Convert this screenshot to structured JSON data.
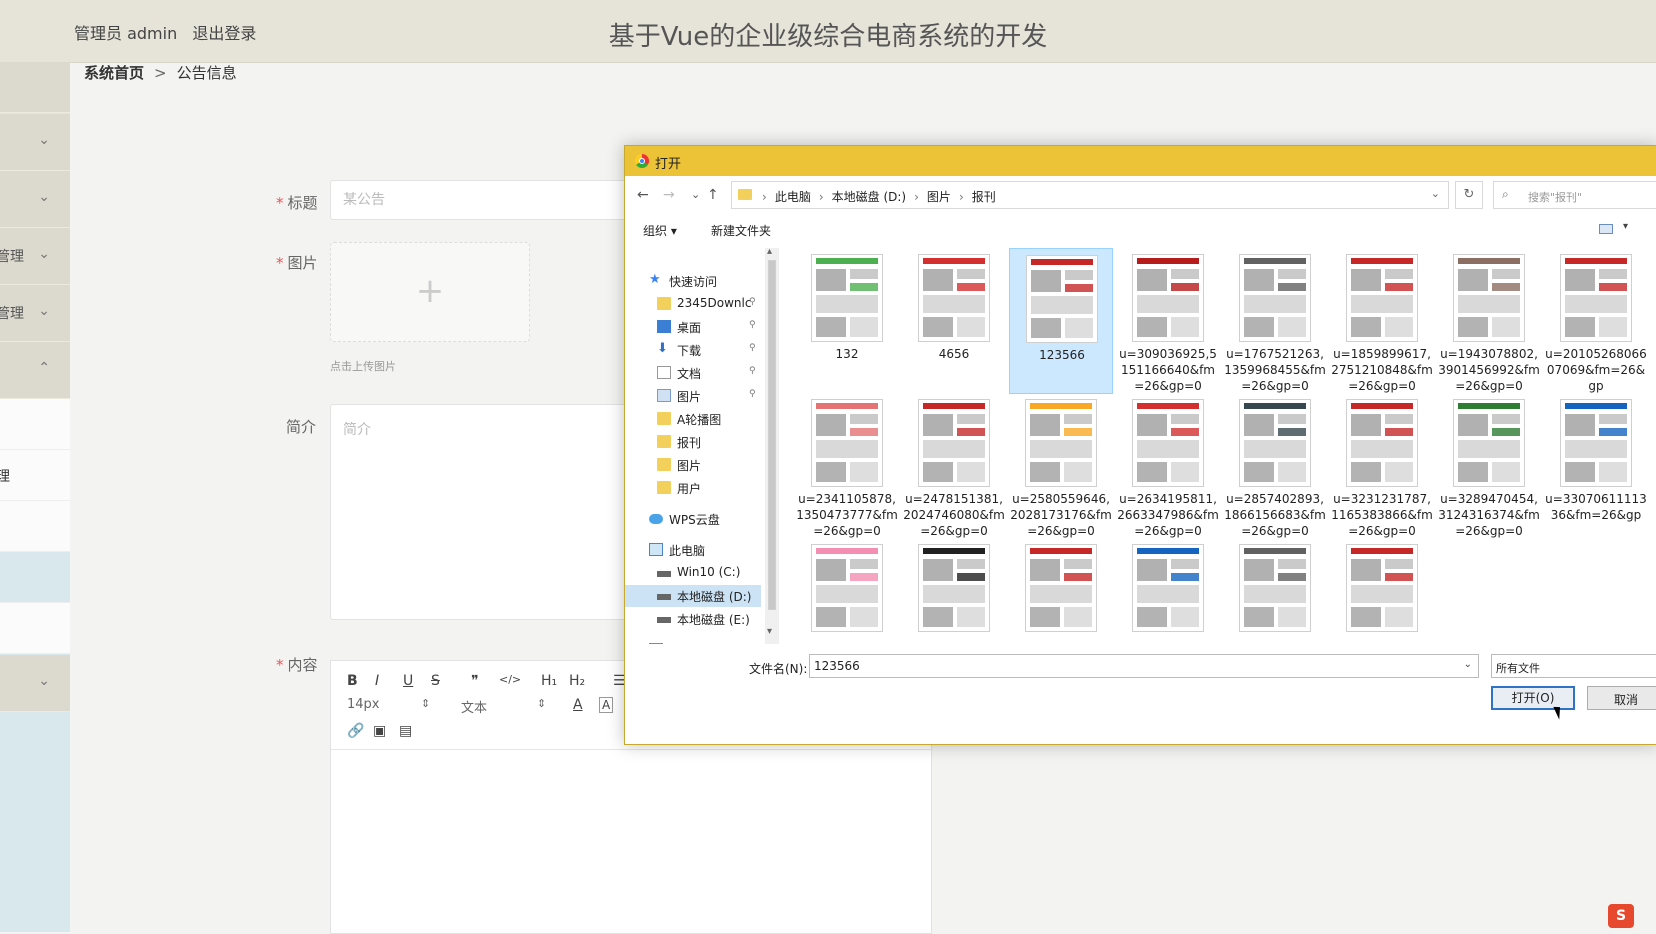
{
  "header": {
    "user_label": "管理员 admin",
    "logout": "退出登录",
    "title": "基于Vue的企业级综合电商系统的开发"
  },
  "sidebar": {
    "items": [
      {
        "label": "",
        "chevron": ""
      },
      {
        "label": "",
        "chevron": "⌄"
      },
      {
        "label": "",
        "chevron": "⌄"
      },
      {
        "label": "管理",
        "chevron": "⌄"
      },
      {
        "label": "管理",
        "chevron": "⌄"
      },
      {
        "label": "",
        "chevron": "⌃"
      }
    ],
    "subitems": [
      {
        "label": ""
      },
      {
        "label": "理"
      },
      {
        "label": ""
      },
      {
        "label": ""
      },
      {
        "label": ""
      }
    ],
    "last_item": {
      "label": "",
      "chevron": "⌄"
    }
  },
  "breadcrumb": {
    "home": "系统首页",
    "sep": ">",
    "current": "公告信息"
  },
  "form": {
    "title_label": "标题",
    "title_placeholder": "某公告",
    "image_label": "图片",
    "upload_plus": "+",
    "upload_tip": "点击上传图片",
    "intro_label": "简介",
    "intro_placeholder": "简介",
    "content_label": "内容",
    "required_mark": "*"
  },
  "editor": {
    "row1": [
      "B",
      "I",
      "U",
      "S",
      "❞",
      "</>",
      "H₁",
      "H₂",
      "☰"
    ],
    "font_size": "14px",
    "text_type": "文本",
    "color_a": "A",
    "bg_a": "A"
  },
  "dialog": {
    "title": "打开",
    "nav": {
      "back": "←",
      "forward": "→",
      "recent": "⌄",
      "up": "↑",
      "refresh": "↻"
    },
    "path": [
      "此电脑",
      "本地磁盘 (D:)",
      "图片",
      "报刊"
    ],
    "path_sep": "›",
    "path_dropdown": "⌄",
    "search_icon": "⌕",
    "search_placeholder": "搜索\"报刊\"",
    "organize": "组织 ▾",
    "new_folder": "新建文件夹",
    "view_dropdown": "▾",
    "navpane": [
      {
        "label": "快速访问",
        "icon": "star-icon",
        "indent": 0,
        "pinned": false
      },
      {
        "label": "2345Downlc",
        "icon": "folder-icon",
        "indent": 1,
        "pinned": true
      },
      {
        "label": "桌面",
        "icon": "desktop-icon",
        "indent": 1,
        "pinned": true
      },
      {
        "label": "下载",
        "icon": "download-icon",
        "indent": 1,
        "pinned": true
      },
      {
        "label": "文档",
        "icon": "document-icon",
        "indent": 1,
        "pinned": true
      },
      {
        "label": "图片",
        "icon": "pictures-icon",
        "indent": 1,
        "pinned": true
      },
      {
        "label": "A轮播图",
        "icon": "folder-icon",
        "indent": 1,
        "pinned": false
      },
      {
        "label": "报刊",
        "icon": "folder-icon",
        "indent": 1,
        "pinned": false
      },
      {
        "label": "图片",
        "icon": "folder-icon",
        "indent": 1,
        "pinned": false
      },
      {
        "label": "用户",
        "icon": "folder-icon",
        "indent": 1,
        "pinned": false
      },
      {
        "label": "WPS云盘",
        "icon": "cloud-icon",
        "indent": 0,
        "pinned": false
      },
      {
        "label": "此电脑",
        "icon": "computer-icon",
        "indent": 0,
        "pinned": false
      },
      {
        "label": "Win10 (C:)",
        "icon": "drive-icon",
        "indent": 1,
        "pinned": false
      },
      {
        "label": "本地磁盘 (D:)",
        "icon": "drive-icon",
        "indent": 1,
        "pinned": false,
        "selected": true
      },
      {
        "label": "本地磁盘 (E:)",
        "icon": "drive-icon",
        "indent": 1,
        "pinned": false
      },
      {
        "label": "网络",
        "icon": "network-icon",
        "indent": 0,
        "pinned": false
      }
    ],
    "pin_glyph": "📌",
    "files": [
      {
        "name": "132",
        "accent": "#4caf50"
      },
      {
        "name": "4656",
        "accent": "#d32f2f"
      },
      {
        "name": "123566",
        "accent": "#c62828",
        "selected": true
      },
      {
        "name": "u=309036925,5151166640&fm=26&gp=0",
        "accent": "#b71c1c"
      },
      {
        "name": "u=1767521263,1359968455&fm=26&gp=0",
        "accent": "#616161"
      },
      {
        "name": "u=1859899617,2751210848&fm=26&gp=0",
        "accent": "#c62828"
      },
      {
        "name": "u=1943078802,3901456992&fm=26&gp=0",
        "accent": "#8d6e63"
      },
      {
        "name": "u=2010526806607069&fm=26&gp",
        "accent": "#c62828"
      },
      {
        "name": "u=2341105878,1350473777&fm=26&gp=0",
        "accent": "#e57373"
      },
      {
        "name": "u=2478151381,2024746080&fm=26&gp=0",
        "accent": "#c62828"
      },
      {
        "name": "u=2580559646,2028173176&fm=26&gp=0",
        "accent": "#f9a825"
      },
      {
        "name": "u=2634195811,2663347986&fm=26&gp=0",
        "accent": "#d32f2f"
      },
      {
        "name": "u=2857402893,1866156683&fm=26&gp=0",
        "accent": "#37474f"
      },
      {
        "name": "u=3231231787,1165383866&fm=26&gp=0",
        "accent": "#c62828"
      },
      {
        "name": "u=3289470454,3124316374&fm=26&gp=0",
        "accent": "#2e7d32"
      },
      {
        "name": "u=3307061111336&fm=26&gp",
        "accent": "#1565c0"
      },
      {
        "name": "",
        "accent": "#f48fb1"
      },
      {
        "name": "",
        "accent": "#212121"
      },
      {
        "name": "",
        "accent": "#c62828"
      },
      {
        "name": "",
        "accent": "#1565c0"
      },
      {
        "name": "",
        "accent": "#616161"
      },
      {
        "name": "",
        "accent": "#c62828"
      }
    ],
    "filename_label": "文件名(N):",
    "filename_value": "123566",
    "filetype": "所有文件",
    "open_button": "打开(O)",
    "cancel_button": "取消"
  },
  "ime": {
    "label": "S"
  },
  "colors": {
    "header_bg": "#e6e3d8",
    "dialog_title": "#ecc337",
    "selection": "#cce8ff",
    "required": "#e55555"
  }
}
